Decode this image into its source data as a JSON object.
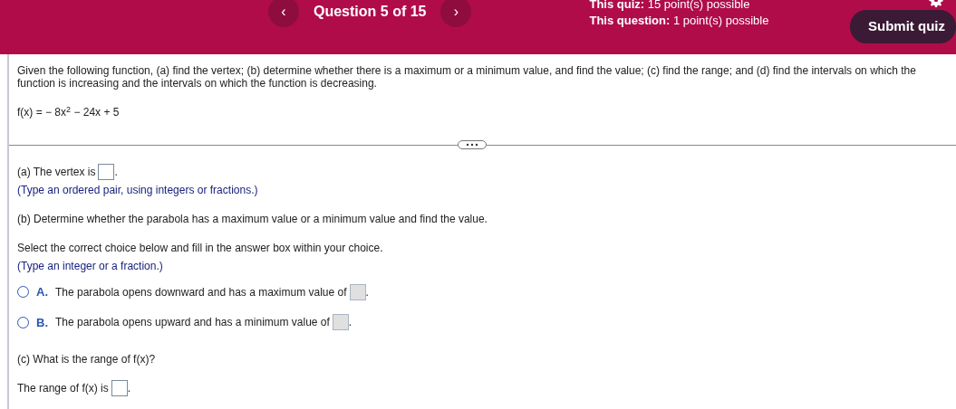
{
  "header": {
    "prev_button": "‹",
    "title": "Question 5 of 15",
    "next_button": "›",
    "quiz_points": {
      "label": "This quiz:",
      "value": "15 point(s) possible"
    },
    "question_points": {
      "label": "This question:",
      "value": "1 point(s) possible"
    },
    "submit_button": "Submit quiz"
  },
  "question": {
    "instructions": "Given the following function, (a) find the vertex; (b) determine whether there is a maximum or a minimum value, and find the value; (c) find the range; and (d) find the intervals on which the function is increasing and the intervals on which the function is decreasing.",
    "function": "f(x) = − 8x$^{2}$ − 24x + 5"
  },
  "parts": [
    {
      "kind": "answer",
      "text": "(a) The vertex is",
      "box_disabled": false,
      "after": "."
    },
    {
      "kind": "hint",
      "text": "(Type an ordered pair, using integers or fractions.)"
    },
    {
      "kind": "prompt",
      "text": "(b) Determine whether the parabola has a maximum value or a minimum value and find the value."
    },
    {
      "kind": "prompt",
      "text": "Select the correct choice below and fill in the answer box within your choice."
    },
    {
      "kind": "hint",
      "text": "(Type an integer or a fraction.)"
    },
    {
      "kind": "choice",
      "letter": "A.",
      "text": "The parabola opens downward and has a maximum value of",
      "selected": false,
      "box_disabled": true,
      "after": "."
    },
    {
      "kind": "choice",
      "letter": "B.",
      "text": "The parabola opens upward and has a minimum value of",
      "selected": false,
      "box_disabled": true,
      "after": "."
    },
    {
      "kind": "prompt",
      "text": "(c) What is the range of f(x)?"
    },
    {
      "kind": "answer",
      "text": "The range of f(x) is",
      "box_disabled": false,
      "after": "."
    }
  ]
}
